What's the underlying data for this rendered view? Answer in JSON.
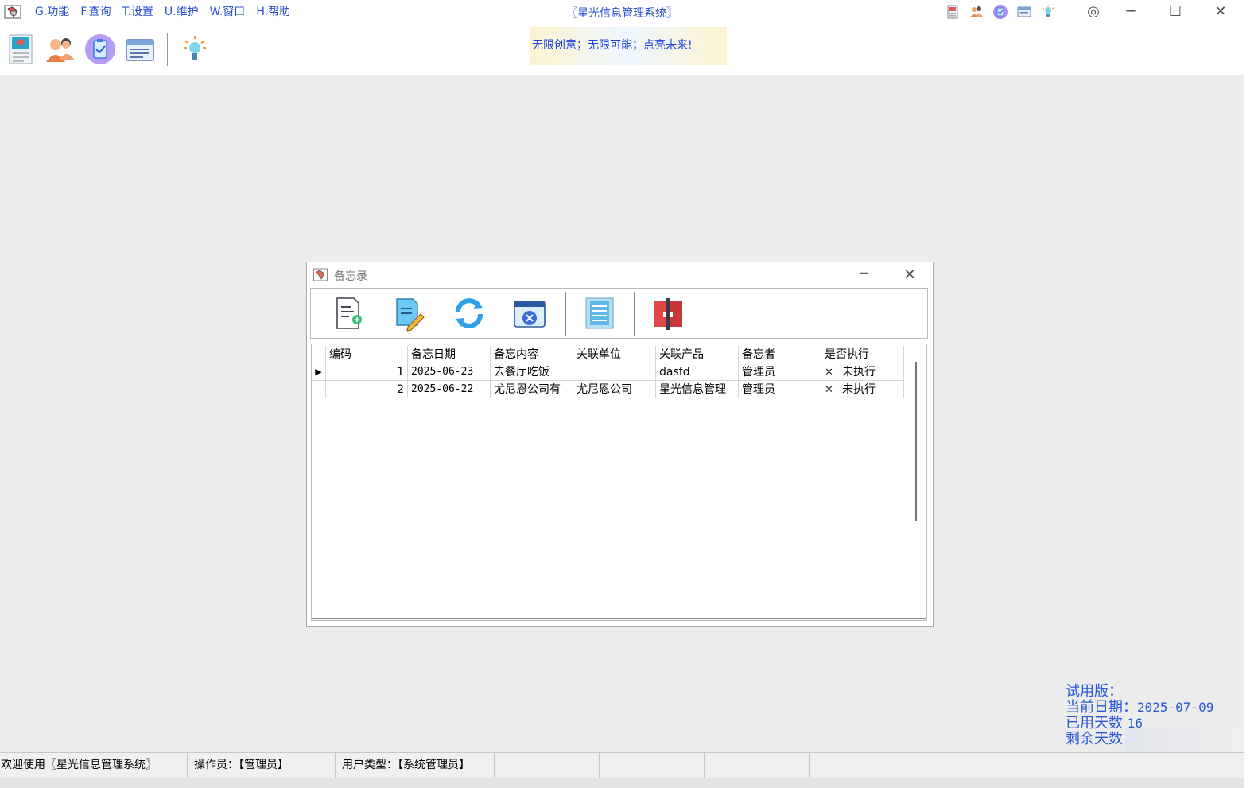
{
  "app": {
    "title": "〖星光信息管理系统〗",
    "slogan": "无限创意；无限可能；点亮未来!"
  },
  "menu": [
    "G.功能",
    "F.查询",
    "T.设置",
    "U.维护",
    "W.窗口",
    "H.帮助"
  ],
  "window_controls": {
    "settings_glyph": "◎",
    "minimize": "─",
    "maximize": "☐",
    "close": "✕"
  },
  "toolbar_icons": [
    "profile-card-icon",
    "users-icon",
    "clipboard-check-icon",
    "calendar-card-icon",
    "lightbulb-icon"
  ],
  "dialog": {
    "title": "备忘录",
    "minimize": "─",
    "close": "✕",
    "tools": [
      "add-document-icon",
      "edit-document-icon",
      "refresh-icon",
      "calendar-delete-icon",
      "report-list-icon",
      "exit-door-icon"
    ]
  },
  "table": {
    "columns": [
      "编码",
      "备忘日期",
      "备忘内容",
      "关联单位",
      "关联产品",
      "备忘者",
      "是否执行"
    ],
    "rows": [
      {
        "indicator": "▶",
        "id": "1",
        "date": "2025-06-23",
        "content": "去餐厅吃饭",
        "unit": "",
        "product": "dasfd",
        "who": "管理员",
        "check": "✕",
        "exec": "未执行"
      },
      {
        "indicator": "",
        "id": "2",
        "date": "2025-06-22",
        "content": "尤尼恩公司有",
        "unit": "尤尼恩公司",
        "product": "星光信息管理",
        "who": "管理员",
        "check": "✕",
        "exec": "未执行"
      }
    ]
  },
  "trial": {
    "label_version": "试用版：",
    "label_date": "当前日期：",
    "date": "2025-07-09",
    "label_used": "已用天数",
    "used": "16",
    "label_left": "剩余天数"
  },
  "status": {
    "welcome": "欢迎使用〖星光信息管理系统〗",
    "operator": "操作员：【管理员】",
    "user_type": "用户类型：【系统管理员】"
  },
  "colors": {
    "accent": "#2a4fd0",
    "slogan_text": "#1d3fe0",
    "info_text": "#2a59d8"
  }
}
